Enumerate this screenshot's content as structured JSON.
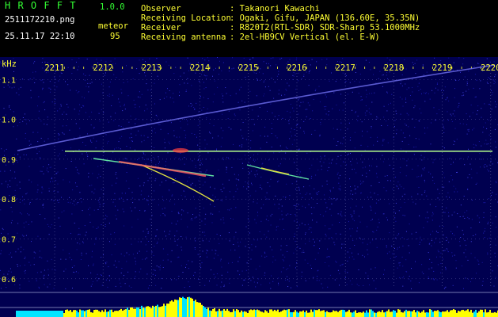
{
  "app": {
    "name": "H R O F F T",
    "version": "1.0.0",
    "filename": "2511172210.png",
    "datetime": "25.11.17 22:10",
    "mode_label": "meteor",
    "count": "95"
  },
  "station": [
    {
      "key": "Observer",
      "value": ": Takanori Kawachi"
    },
    {
      "key": "Receiving Location",
      "value": ": Ogaki, Gifu, JAPAN (136.60E, 35.35N)"
    },
    {
      "key": "Receiver",
      "value": ": R820T2(RTL-SDR) SDR-Sharp 53.1000MHz"
    },
    {
      "key": "Receiving antenna",
      "value": ": 2el-HB9CV Vertical (el. E-W)"
    }
  ],
  "chart_data": {
    "type": "heatmap",
    "ylabel": "kHz",
    "x_ticks": [
      "2211",
      "2212",
      "2213",
      "2214",
      "2215",
      "2216",
      "2217",
      "2218",
      "2219",
      "2220"
    ],
    "y_ticks": [
      "1.1",
      "1.0",
      "0.9",
      "0.8",
      "0.7",
      "0.6"
    ],
    "ylim": [
      0.58,
      1.17
    ],
    "carrier_khz": 0.92,
    "colors": {
      "background": "#000050",
      "grid": "#5a5aa0",
      "tick_labels": "#ffff33",
      "carrier": "#aaee88",
      "histogram": "#ffff00",
      "histogram_base": "#00e5ff"
    }
  }
}
